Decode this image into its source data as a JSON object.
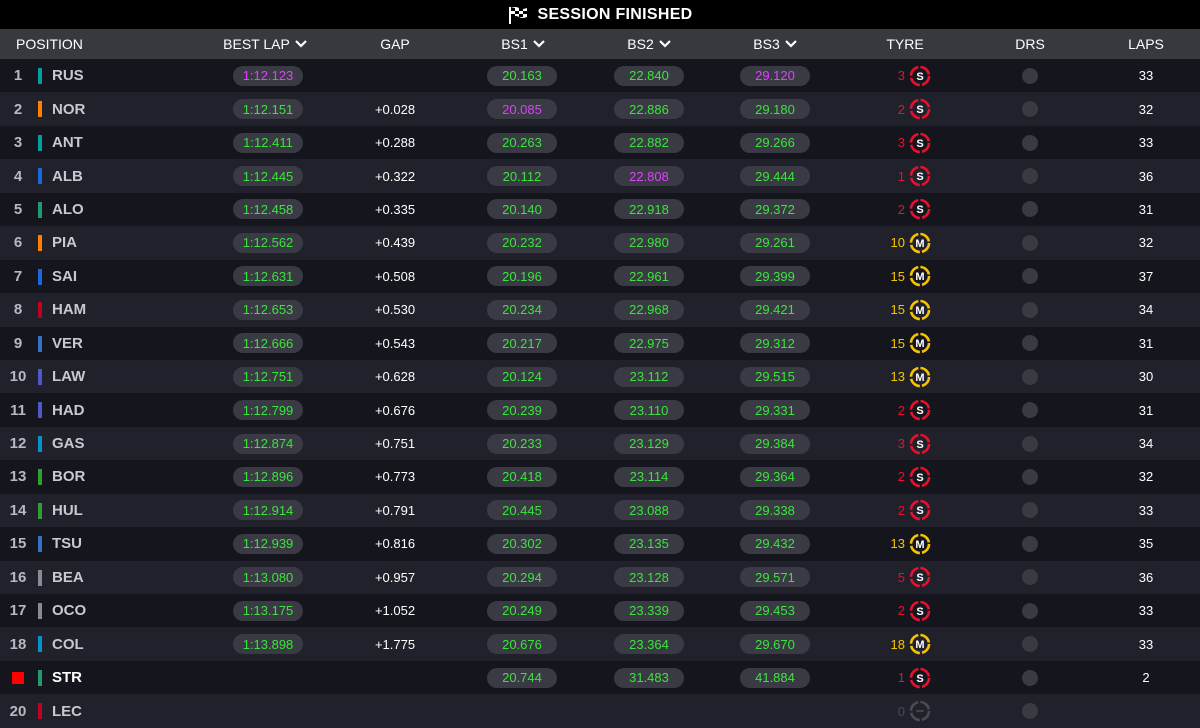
{
  "banner": {
    "title": "SESSION FINISHED",
    "icon": "checkered-flag-icon"
  },
  "columns": {
    "position": "POSITION",
    "best_lap": "BEST LAP",
    "gap": "GAP",
    "bs1": "BS1",
    "bs2": "BS2",
    "bs3": "BS3",
    "tyre": "TYRE",
    "drs": "DRS",
    "laps": "LAPS"
  },
  "colors": {
    "green": "#39e53a",
    "purple": "#e040ff",
    "soft": "#e8102c",
    "medium": "#f5c400",
    "inactive": "#4a4a52"
  },
  "rows": [
    {
      "pos": "1",
      "code": "RUS",
      "team": "#00a19c",
      "best": "1:12.123",
      "best_c": "purple",
      "gap": "",
      "bs1": "20.163",
      "bs1_c": "green",
      "bs2": "22.840",
      "bs2_c": "green",
      "bs3": "29.120",
      "bs3_c": "purple",
      "tyre_age": "3",
      "compound": "S",
      "laps": "33"
    },
    {
      "pos": "2",
      "code": "NOR",
      "team": "#ff8000",
      "best": "1:12.151",
      "best_c": "green",
      "gap": "+0.028",
      "bs1": "20.085",
      "bs1_c": "purple",
      "bs2": "22.886",
      "bs2_c": "green",
      "bs3": "29.180",
      "bs3_c": "green",
      "tyre_age": "2",
      "compound": "S",
      "laps": "32"
    },
    {
      "pos": "3",
      "code": "ANT",
      "team": "#00a19c",
      "best": "1:12.411",
      "best_c": "green",
      "gap": "+0.288",
      "bs1": "20.263",
      "bs1_c": "green",
      "bs2": "22.882",
      "bs2_c": "green",
      "bs3": "29.266",
      "bs3_c": "green",
      "tyre_age": "3",
      "compound": "S",
      "laps": "33"
    },
    {
      "pos": "4",
      "code": "ALB",
      "team": "#1868db",
      "best": "1:12.445",
      "best_c": "green",
      "gap": "+0.322",
      "bs1": "20.112",
      "bs1_c": "green",
      "bs2": "22.808",
      "bs2_c": "purple",
      "bs3": "29.444",
      "bs3_c": "green",
      "tyre_age": "1",
      "compound": "S",
      "laps": "36"
    },
    {
      "pos": "5",
      "code": "ALO",
      "team": "#229971",
      "best": "1:12.458",
      "best_c": "green",
      "gap": "+0.335",
      "bs1": "20.140",
      "bs1_c": "green",
      "bs2": "22.918",
      "bs2_c": "green",
      "bs3": "29.372",
      "bs3_c": "green",
      "tyre_age": "2",
      "compound": "S",
      "laps": "31"
    },
    {
      "pos": "6",
      "code": "PIA",
      "team": "#ff8000",
      "best": "1:12.562",
      "best_c": "green",
      "gap": "+0.439",
      "bs1": "20.232",
      "bs1_c": "green",
      "bs2": "22.980",
      "bs2_c": "green",
      "bs3": "29.261",
      "bs3_c": "green",
      "tyre_age": "10",
      "compound": "M",
      "laps": "32"
    },
    {
      "pos": "7",
      "code": "SAI",
      "team": "#1868db",
      "best": "1:12.631",
      "best_c": "green",
      "gap": "+0.508",
      "bs1": "20.196",
      "bs1_c": "green",
      "bs2": "22.961",
      "bs2_c": "green",
      "bs3": "29.399",
      "bs3_c": "green",
      "tyre_age": "15",
      "compound": "M",
      "laps": "37"
    },
    {
      "pos": "8",
      "code": "HAM",
      "team": "#c00020",
      "best": "1:12.653",
      "best_c": "green",
      "gap": "+0.530",
      "bs1": "20.234",
      "bs1_c": "green",
      "bs2": "22.968",
      "bs2_c": "green",
      "bs3": "29.421",
      "bs3_c": "green",
      "tyre_age": "15",
      "compound": "M",
      "laps": "34"
    },
    {
      "pos": "9",
      "code": "VER",
      "team": "#3671c6",
      "best": "1:12.666",
      "best_c": "green",
      "gap": "+0.543",
      "bs1": "20.217",
      "bs1_c": "green",
      "bs2": "22.975",
      "bs2_c": "green",
      "bs3": "29.312",
      "bs3_c": "green",
      "tyre_age": "15",
      "compound": "M",
      "laps": "31"
    },
    {
      "pos": "10",
      "code": "LAW",
      "team": "#4a5ac8",
      "best": "1:12.751",
      "best_c": "green",
      "gap": "+0.628",
      "bs1": "20.124",
      "bs1_c": "green",
      "bs2": "23.112",
      "bs2_c": "green",
      "bs3": "29.515",
      "bs3_c": "green",
      "tyre_age": "13",
      "compound": "M",
      "laps": "30"
    },
    {
      "pos": "11",
      "code": "HAD",
      "team": "#4a5ac8",
      "best": "1:12.799",
      "best_c": "green",
      "gap": "+0.676",
      "bs1": "20.239",
      "bs1_c": "green",
      "bs2": "23.110",
      "bs2_c": "green",
      "bs3": "29.331",
      "bs3_c": "green",
      "tyre_age": "2",
      "compound": "S",
      "laps": "31"
    },
    {
      "pos": "12",
      "code": "GAS",
      "team": "#0093cc",
      "best": "1:12.874",
      "best_c": "green",
      "gap": "+0.751",
      "bs1": "20.233",
      "bs1_c": "green",
      "bs2": "23.129",
      "bs2_c": "green",
      "bs3": "29.384",
      "bs3_c": "green",
      "tyre_age": "3",
      "compound": "S",
      "laps": "34"
    },
    {
      "pos": "13",
      "code": "BOR",
      "team": "#2fa030",
      "best": "1:12.896",
      "best_c": "green",
      "gap": "+0.773",
      "bs1": "20.418",
      "bs1_c": "green",
      "bs2": "23.114",
      "bs2_c": "green",
      "bs3": "29.364",
      "bs3_c": "green",
      "tyre_age": "2",
      "compound": "S",
      "laps": "32"
    },
    {
      "pos": "14",
      "code": "HUL",
      "team": "#2fa030",
      "best": "1:12.914",
      "best_c": "green",
      "gap": "+0.791",
      "bs1": "20.445",
      "bs1_c": "green",
      "bs2": "23.088",
      "bs2_c": "green",
      "bs3": "29.338",
      "bs3_c": "green",
      "tyre_age": "2",
      "compound": "S",
      "laps": "33"
    },
    {
      "pos": "15",
      "code": "TSU",
      "team": "#3671c6",
      "best": "1:12.939",
      "best_c": "green",
      "gap": "+0.816",
      "bs1": "20.302",
      "bs1_c": "green",
      "bs2": "23.135",
      "bs2_c": "green",
      "bs3": "29.432",
      "bs3_c": "green",
      "tyre_age": "13",
      "compound": "M",
      "laps": "35"
    },
    {
      "pos": "16",
      "code": "BEA",
      "team": "#8a8a92",
      "best": "1:13.080",
      "best_c": "green",
      "gap": "+0.957",
      "bs1": "20.294",
      "bs1_c": "green",
      "bs2": "23.128",
      "bs2_c": "green",
      "bs3": "29.571",
      "bs3_c": "green",
      "tyre_age": "5",
      "compound": "S",
      "laps": "36"
    },
    {
      "pos": "17",
      "code": "OCO",
      "team": "#8a8a92",
      "best": "1:13.175",
      "best_c": "green",
      "gap": "+1.052",
      "bs1": "20.249",
      "bs1_c": "green",
      "bs2": "23.339",
      "bs2_c": "green",
      "bs3": "29.453",
      "bs3_c": "green",
      "tyre_age": "2",
      "compound": "S",
      "laps": "33"
    },
    {
      "pos": "18",
      "code": "COL",
      "team": "#0093cc",
      "best": "1:13.898",
      "best_c": "green",
      "gap": "+1.775",
      "bs1": "20.676",
      "bs1_c": "green",
      "bs2": "23.364",
      "bs2_c": "green",
      "bs3": "29.670",
      "bs3_c": "green",
      "tyre_age": "18",
      "compound": "M",
      "laps": "33"
    },
    {
      "pos": "",
      "code": "STR",
      "team": "#229971",
      "stopped": true,
      "best": "",
      "best_c": "green",
      "gap": "",
      "bs1": "20.744",
      "bs1_c": "green",
      "bs2": "31.483",
      "bs2_c": "green",
      "bs3": "41.884",
      "bs3_c": "green",
      "tyre_age": "1",
      "compound": "S",
      "laps": "2"
    },
    {
      "pos": "20",
      "code": "LEC",
      "team": "#c00020",
      "best": "",
      "best_c": "green",
      "gap": "",
      "bs1": "",
      "bs1_c": "green",
      "bs2": "",
      "bs2_c": "green",
      "bs3": "",
      "bs3_c": "green",
      "tyre_age": "0",
      "compound": "",
      "laps": ""
    }
  ]
}
